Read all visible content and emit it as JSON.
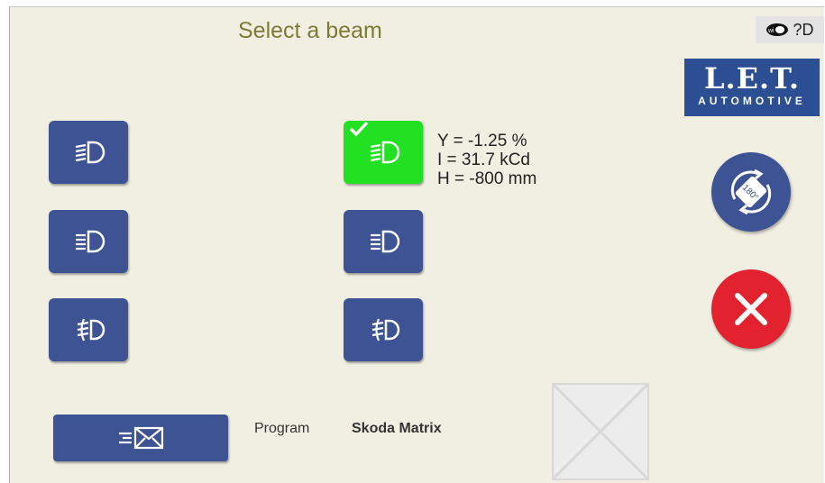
{
  "header": {
    "title": "Select a beam",
    "help_label": "?D"
  },
  "logo": {
    "main": "L.E.T.",
    "sub": "AUTOMOTIVE"
  },
  "beams": [
    {
      "id": "low-left",
      "icon": "low-beam-icon",
      "selected": false
    },
    {
      "id": "low-right",
      "icon": "low-beam-icon",
      "selected": true
    },
    {
      "id": "high-left",
      "icon": "high-beam-icon",
      "selected": false
    },
    {
      "id": "high-right",
      "icon": "high-beam-icon",
      "selected": false
    },
    {
      "id": "fog-left",
      "icon": "fog-light-icon",
      "selected": false
    },
    {
      "id": "fog-right",
      "icon": "fog-light-icon",
      "selected": false
    }
  ],
  "readout": {
    "y": "Y = -1.25 %",
    "i": "I = 31.7 kCd",
    "h": "H = -800 mm"
  },
  "rotate": {
    "label": "180°"
  },
  "program": {
    "label": "Program",
    "value": "Skoda Matrix"
  },
  "colors": {
    "button": "#3e5394",
    "selected": "#22e022",
    "cancel": "#e3222f",
    "title": "#7b7b35"
  }
}
